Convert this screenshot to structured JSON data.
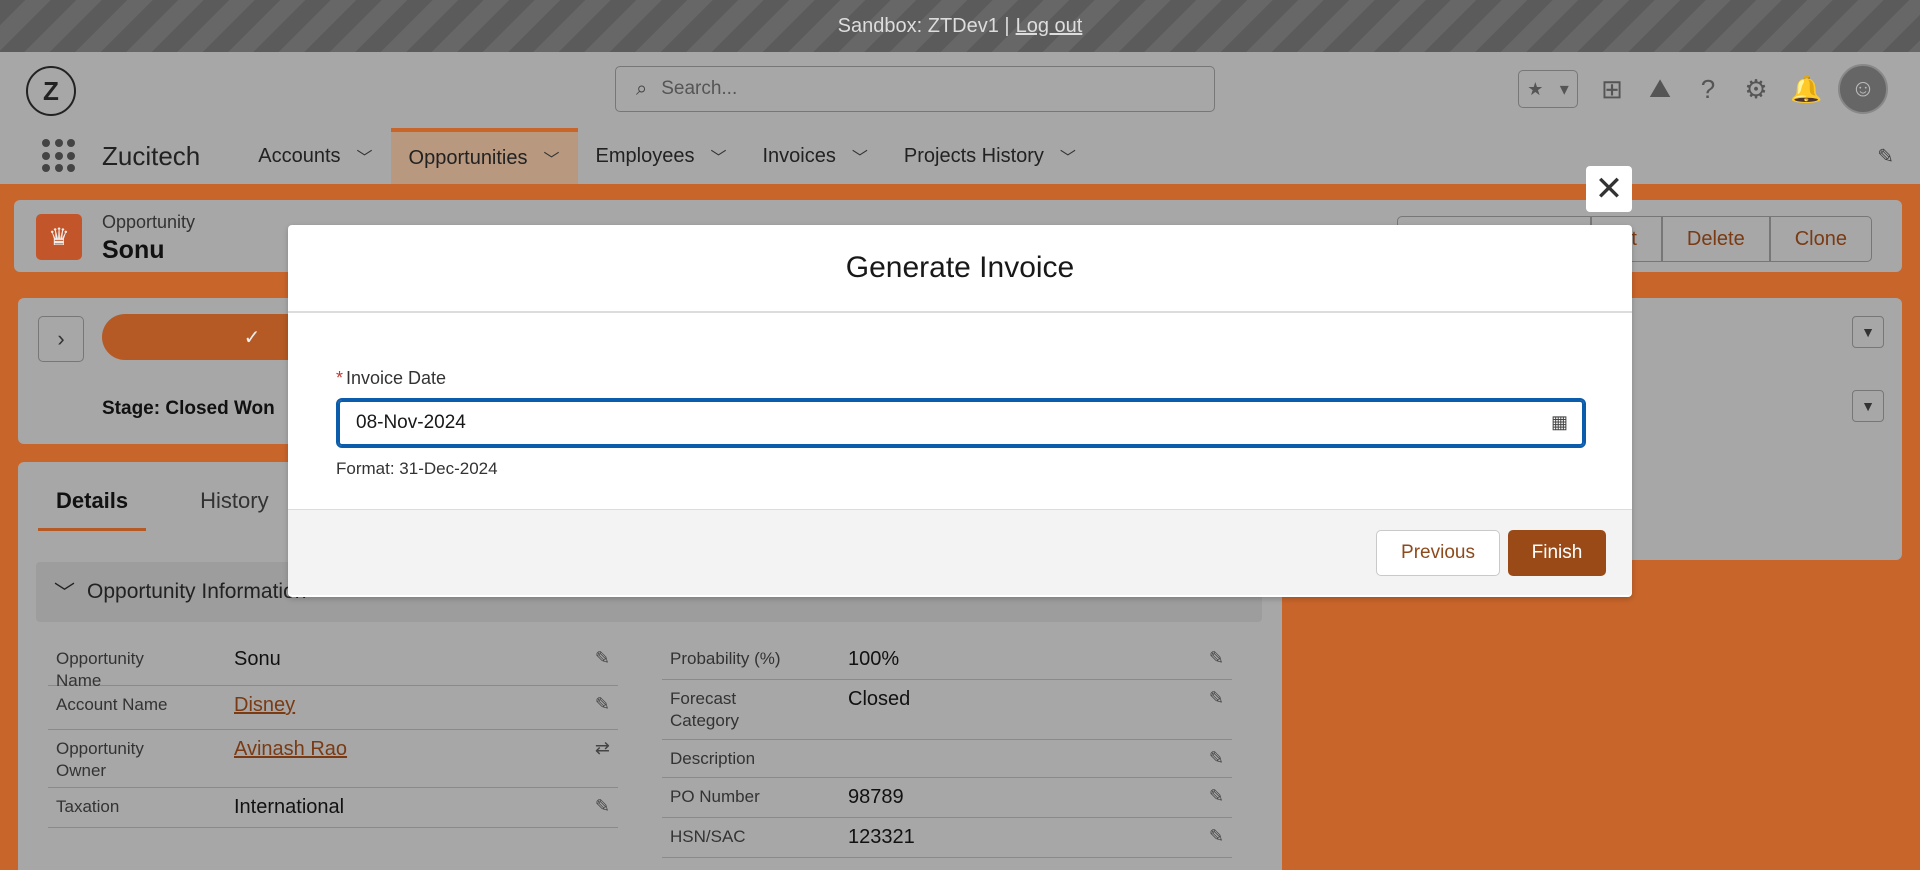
{
  "sandbox": {
    "text": "Sandbox: ZTDev1 |",
    "logout": "Log out"
  },
  "header": {
    "logo_text": "Z",
    "search_placeholder": "Search...",
    "icons": [
      "favorites-star-icon",
      "add-icon",
      "trailhead-icon",
      "help-icon",
      "setup-gear-icon",
      "notification-bell-icon",
      "user-avatar"
    ]
  },
  "app": {
    "name": "Zucitech",
    "nav": [
      {
        "label": "Accounts"
      },
      {
        "label": "Opportunities",
        "active": true
      },
      {
        "label": "Employees"
      },
      {
        "label": "Invoices"
      },
      {
        "label": "Projects History"
      }
    ]
  },
  "record": {
    "type": "Opportunity",
    "name": "Sonu",
    "actions": [
      "",
      "Edit",
      "Delete",
      "Clone"
    ],
    "action_visible": [
      "dit",
      "Delete",
      "Clone"
    ]
  },
  "path": {
    "stage_label": "Stage: Closed Won"
  },
  "details": {
    "tabs": [
      "Details",
      "History"
    ],
    "section_title": "Opportunity Information",
    "left_fields": [
      {
        "label": "Opportunity Name",
        "value": "Sonu"
      },
      {
        "label": "Account Name",
        "value": "Disney"
      },
      {
        "label": "Opportunity Owner",
        "value": "Avinash Rao"
      },
      {
        "label": "Taxation",
        "value": "International"
      }
    ],
    "right_fields": [
      {
        "label": "Probability (%)",
        "value": "100%"
      },
      {
        "label": "Forecast Category",
        "value": "Closed"
      },
      {
        "label": "Description",
        "value": ""
      },
      {
        "label": "PO Number",
        "value": "98789"
      },
      {
        "label": "HSN/SAC",
        "value": "123321"
      }
    ]
  },
  "modal": {
    "title": "Generate Invoice",
    "field_label": "Invoice Date",
    "required_marker": "*",
    "field_value": "08-Nov-2024",
    "format_help": "Format: 31-Dec-2024",
    "previous_label": "Previous",
    "finish_label": "Finish",
    "close_glyph": "✕"
  }
}
